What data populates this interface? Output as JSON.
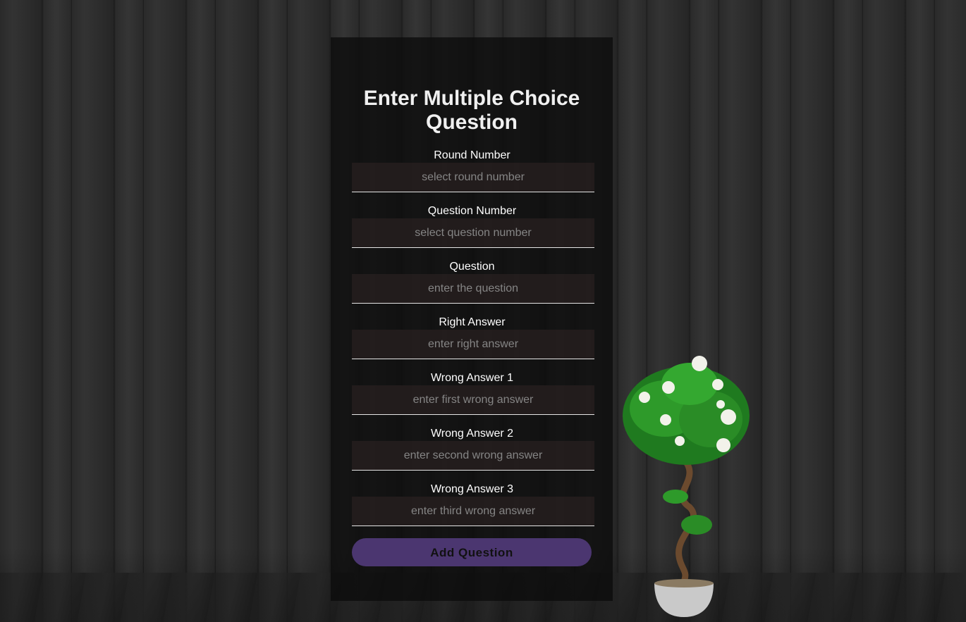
{
  "form": {
    "title": "Enter Multiple Choice Question",
    "fields": [
      {
        "label": "Round Number",
        "placeholder": "select round number"
      },
      {
        "label": "Question Number",
        "placeholder": "select question number"
      },
      {
        "label": "Question",
        "placeholder": "enter the question"
      },
      {
        "label": "Right Answer",
        "placeholder": "enter right answer"
      },
      {
        "label": "Wrong Answer 1",
        "placeholder": "enter first wrong answer"
      },
      {
        "label": "Wrong Answer 2",
        "placeholder": "enter second wrong answer"
      },
      {
        "label": "Wrong Answer 3",
        "placeholder": "enter third wrong answer"
      }
    ],
    "submit_label": "Add Question"
  },
  "colors": {
    "panel": "#0c0c0c",
    "button": "#4b3670",
    "input_bg": "#282020"
  },
  "decor": {
    "icon": "potted-plant-icon"
  }
}
